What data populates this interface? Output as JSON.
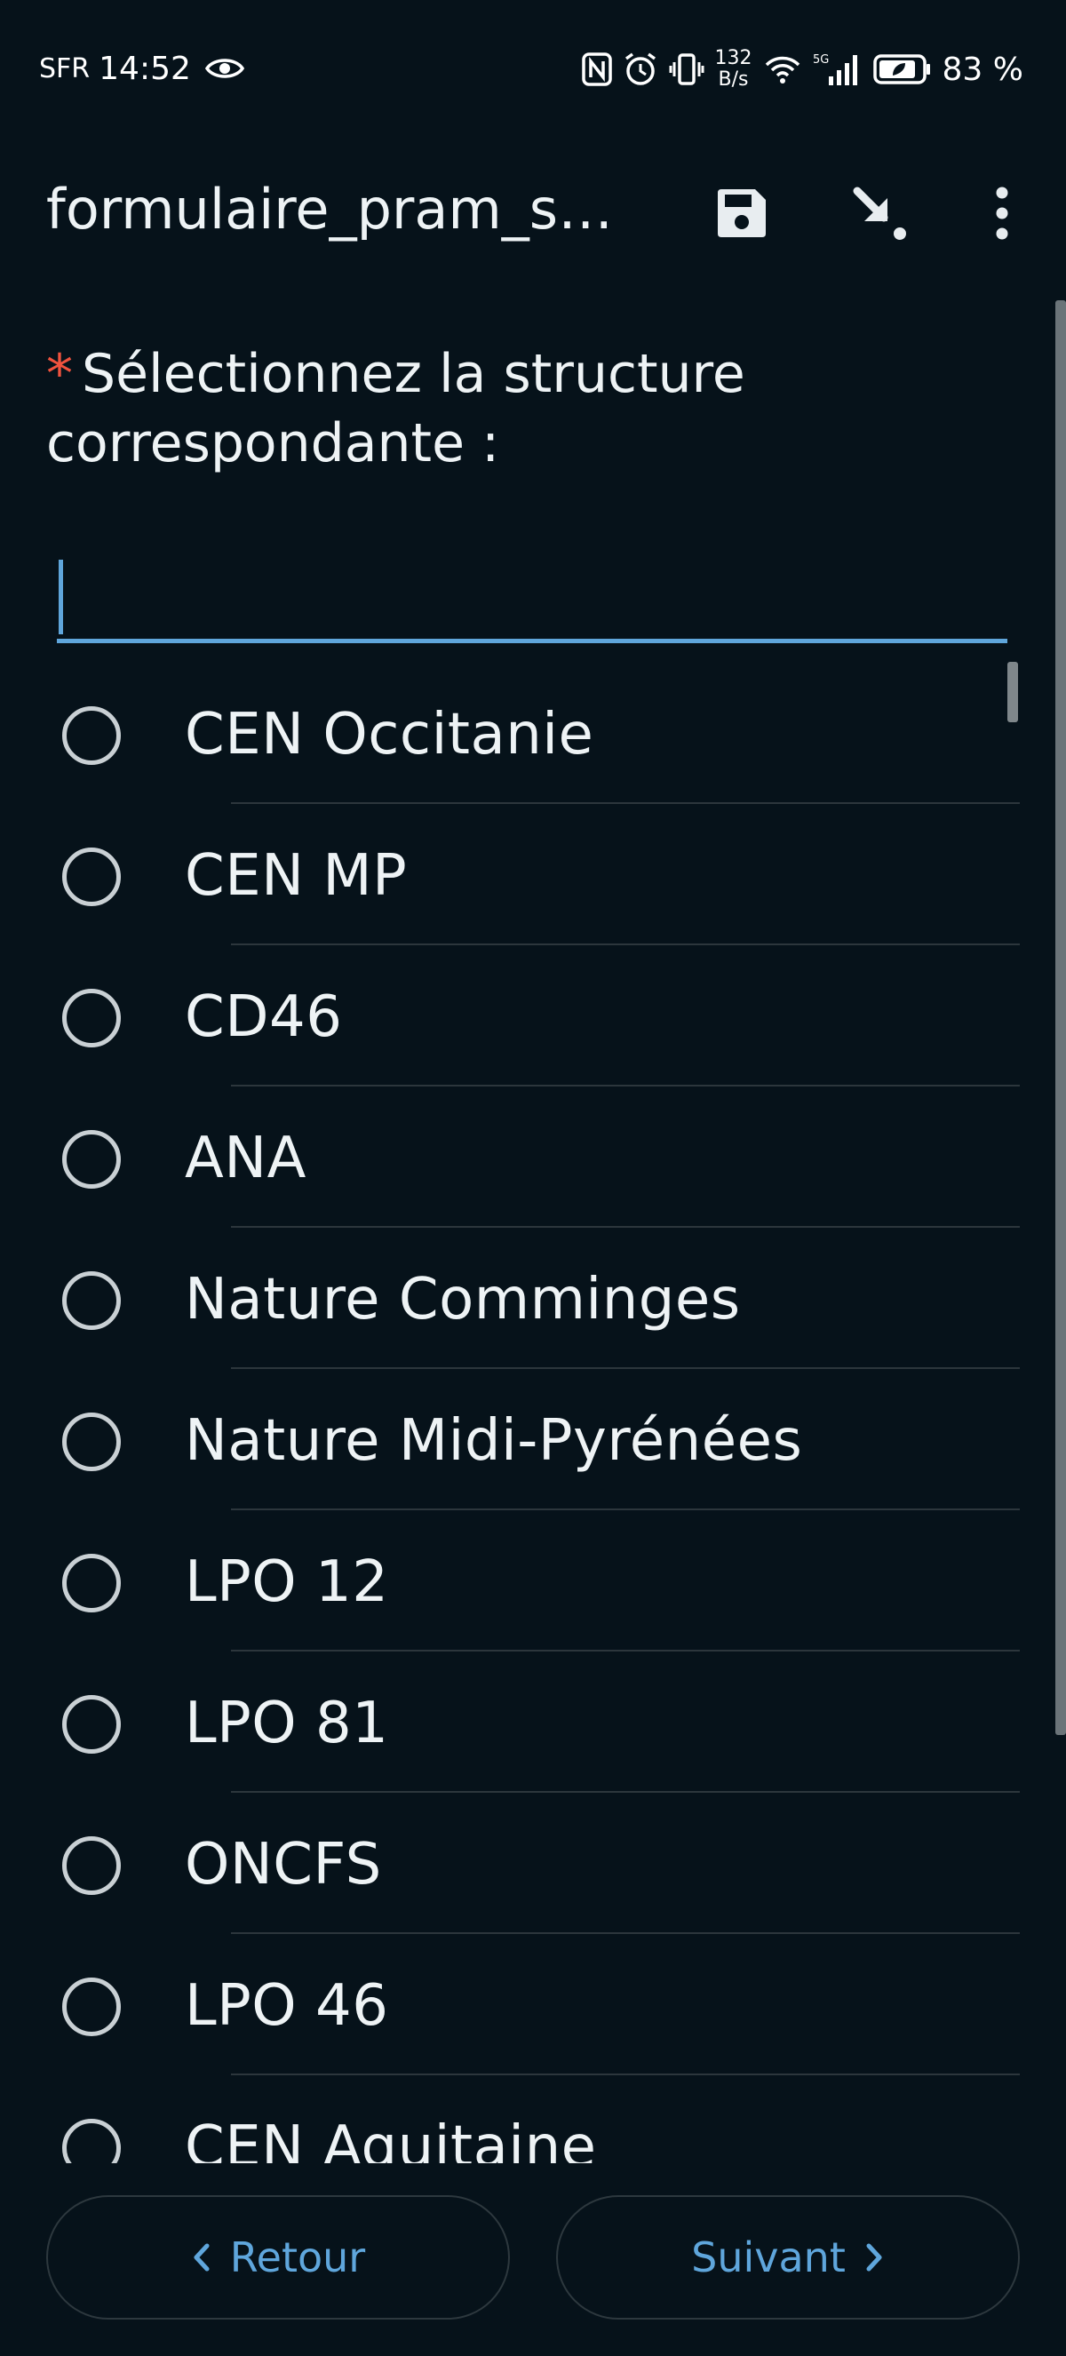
{
  "status_bar": {
    "carrier": "SFR",
    "time": "14:52",
    "net_speed_value": "132",
    "net_speed_unit": "B/s",
    "battery_percent": "83 %",
    "network_type": "5G"
  },
  "app_bar": {
    "title": "formulaire_pram_si..."
  },
  "question": {
    "required_marker": "*",
    "text": "Sélectionnez la structure correspondante :"
  },
  "search": {
    "value": "",
    "placeholder": ""
  },
  "options": [
    {
      "label": "CEN Occitanie",
      "selected": false
    },
    {
      "label": "CEN MP",
      "selected": false
    },
    {
      "label": "CD46",
      "selected": false
    },
    {
      "label": "ANA",
      "selected": false
    },
    {
      "label": "Nature Comminges",
      "selected": false
    },
    {
      "label": "Nature Midi-Pyrénées",
      "selected": false
    },
    {
      "label": "LPO 12",
      "selected": false
    },
    {
      "label": "LPO 81",
      "selected": false
    },
    {
      "label": "ONCFS",
      "selected": false
    },
    {
      "label": "LPO 46",
      "selected": false
    },
    {
      "label": "CEN Aquitaine",
      "selected": false
    }
  ],
  "navigation": {
    "back_label": "Retour",
    "next_label": "Suivant"
  },
  "colors": {
    "background": "#06121a",
    "accent": "#5fa6dc",
    "required": "#f0533e",
    "text": "#eef3f5"
  }
}
